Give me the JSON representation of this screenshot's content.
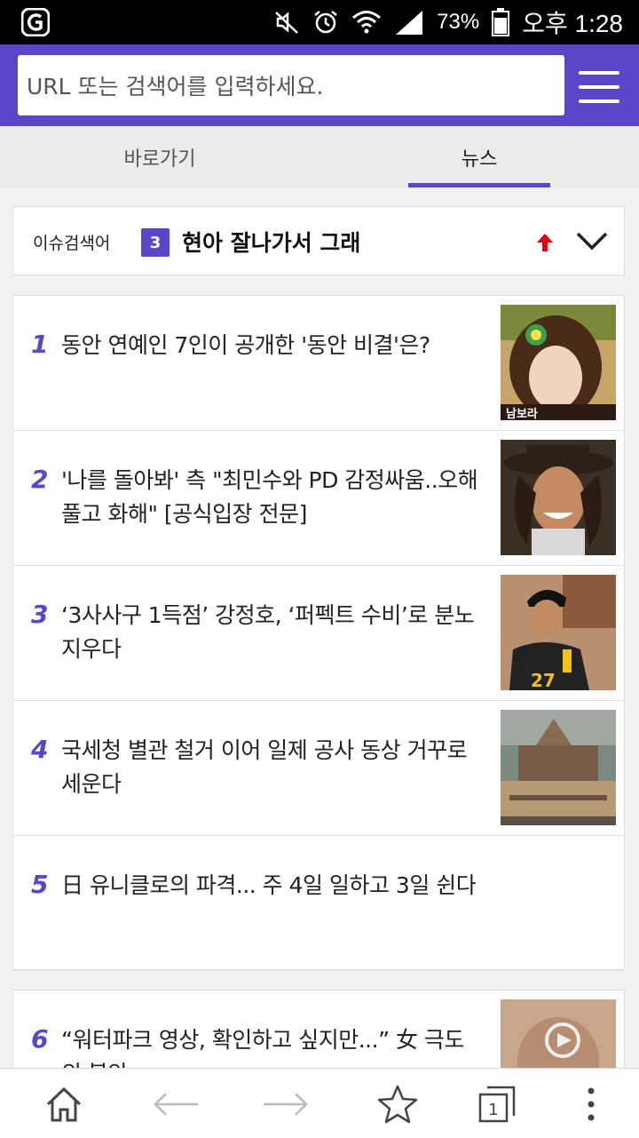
{
  "status_bar": {
    "battery": "73%",
    "time": "오후 1:28",
    "icons": [
      "app-logo-icon",
      "mute-icon",
      "alarm-icon",
      "wifi-icon",
      "signal-icon",
      "battery-icon"
    ]
  },
  "url_bar": {
    "placeholder": "URL 또는 검색어를 입력하세요.",
    "menu_icon": "hamburger-menu-icon",
    "accent_color": "#5b45c9"
  },
  "tabs": [
    {
      "label": "바로가기",
      "active": false
    },
    {
      "label": "뉴스",
      "active": true
    }
  ],
  "issue": {
    "label": "이슈검색어",
    "rank": "3",
    "keyword": "현아 잘나가서 그래",
    "trend": "up"
  },
  "news": [
    {
      "rank": "1",
      "title": "동안 연예인 7인이 공개한 '동안 비결'은?",
      "thumb_caption": "남보라"
    },
    {
      "rank": "2",
      "title": "'나를 돌아봐' 측 \"최민수와 PD 감정싸움..오해 풀고 화해\" [공식입장 전문]"
    },
    {
      "rank": "3",
      "title": "‘3사사구 1득점’ 강정호, ‘퍼펙트 수비’로 분노 지우다",
      "thumb_caption": "27"
    },
    {
      "rank": "4",
      "title": "국세청 별관 철거 이어 일제 공사 동상 거꾸로 세운다"
    },
    {
      "rank": "5",
      "title": "日 유니클로의 파격... 주 4일 일하고 3일 쉰다"
    },
    {
      "rank": "6",
      "title": "“워터파크 영상, 확인하고 싶지만...” 女 극도의 불안"
    }
  ],
  "bottom_nav": {
    "tab_count": "1",
    "icons": [
      "home-icon",
      "back-arrow-icon",
      "forward-arrow-icon",
      "star-bookmark-icon",
      "tabs-icon",
      "more-vertical-icon"
    ]
  }
}
